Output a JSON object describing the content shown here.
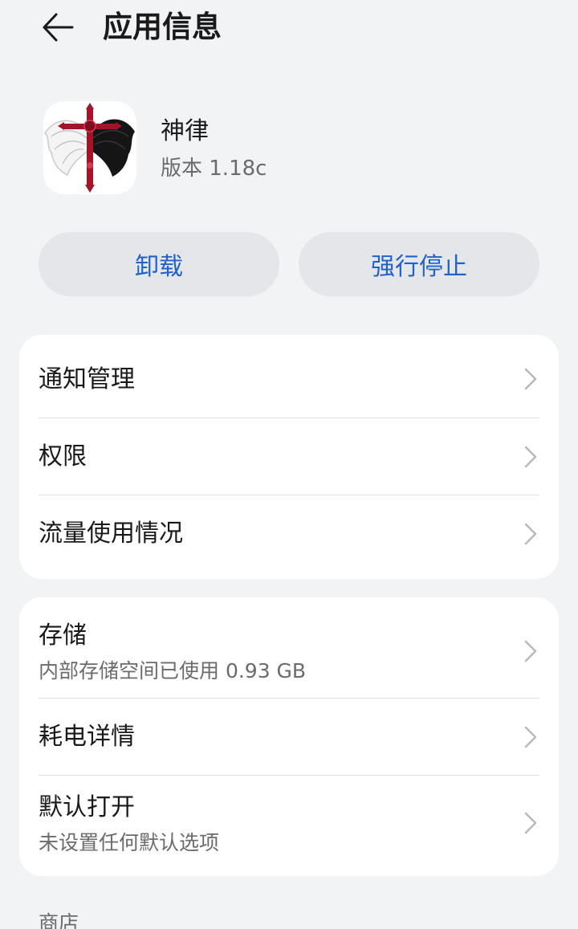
{
  "header": {
    "title": "应用信息",
    "back_icon": "arrow-left-icon"
  },
  "app": {
    "name": "神律",
    "version": "版本 1.18c",
    "icon": "winged-cross-icon"
  },
  "actions": {
    "uninstall_label": "卸载",
    "force_stop_label": "强行停止",
    "accent_color": "#1f62c9"
  },
  "group1": {
    "items": [
      {
        "title": "通知管理"
      },
      {
        "title": "权限"
      },
      {
        "title": "流量使用情况"
      }
    ]
  },
  "group2": {
    "items": [
      {
        "title": "存储",
        "subtitle": "内部存储空间已使用 0.93 GB"
      },
      {
        "title": "耗电详情"
      },
      {
        "title": "默认打开",
        "subtitle": "未设置任何默认选项"
      }
    ]
  },
  "footer": {
    "section_label": "商店"
  }
}
